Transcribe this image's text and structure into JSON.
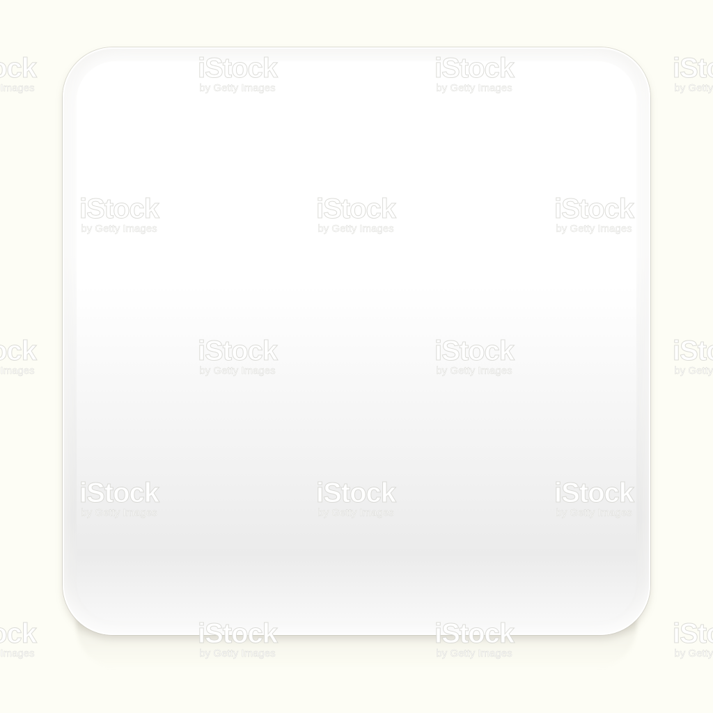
{
  "image": {
    "background_color": "#fdfdf5",
    "tile_color": "#ffffff",
    "tile_shadow_color": "#bebcaa"
  },
  "watermark": {
    "logo_text": "iStock",
    "sub_text": "by Getty Images",
    "color": "#dcdcd7",
    "rows": [
      {
        "columns": 3
      },
      {
        "columns": 3
      },
      {
        "columns": 3
      },
      {
        "columns": 3
      },
      {
        "columns": 3
      }
    ]
  }
}
